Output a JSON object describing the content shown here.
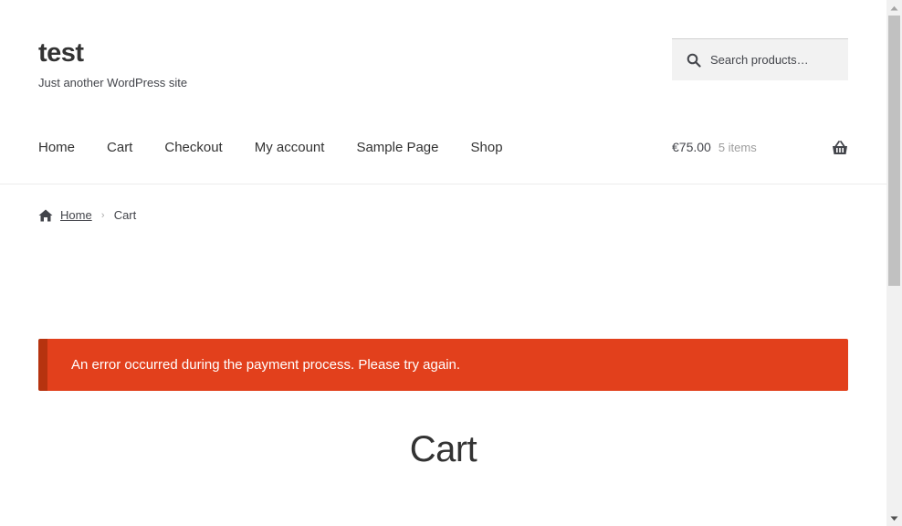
{
  "site": {
    "title": "test",
    "tagline": "Just another WordPress site"
  },
  "search": {
    "placeholder": "Search products…",
    "icon": "search-icon"
  },
  "nav": {
    "items": [
      "Home",
      "Cart",
      "Checkout",
      "My account",
      "Sample Page",
      "Shop"
    ]
  },
  "cart_summary": {
    "amount": "€75.00",
    "count": "5 items",
    "icon": "basket-icon"
  },
  "breadcrumb": {
    "home": "Home",
    "separator": "›",
    "current": "Cart"
  },
  "notice": {
    "text": "An error occurred during the payment process. Please try again.",
    "color": "#e2401c",
    "border_color": "#b6330f"
  },
  "page": {
    "heading": "Cart"
  }
}
